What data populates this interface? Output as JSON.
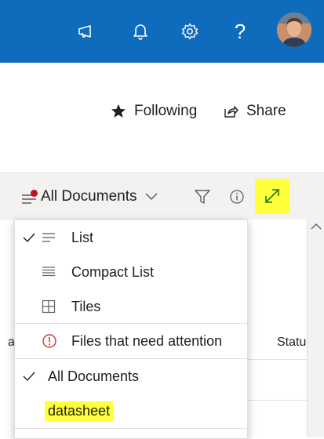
{
  "header": {
    "icons": [
      "megaphone-icon",
      "bell-icon",
      "gear-icon",
      "question-icon"
    ],
    "help_symbol": "?",
    "brand_color": "#0f6cbd"
  },
  "actions": {
    "following_label": "Following",
    "share_label": "Share"
  },
  "command_bar": {
    "view_name": "All Documents",
    "status_column_label": "Statu",
    "left_col_fragment": "a"
  },
  "view_menu": {
    "layout_items": [
      {
        "label": "List",
        "checked": true
      },
      {
        "label": "Compact List",
        "checked": false
      },
      {
        "label": "Tiles",
        "checked": false
      }
    ],
    "attention_item": "Files that need attention",
    "views": [
      {
        "label": "All Documents",
        "checked": true
      },
      {
        "label": "datasheet",
        "checked": false,
        "highlighted": true
      }
    ]
  },
  "colors": {
    "highlight": "#ffff3a",
    "alert_red": "#d13438",
    "notification_dot": "#c50f1f"
  }
}
